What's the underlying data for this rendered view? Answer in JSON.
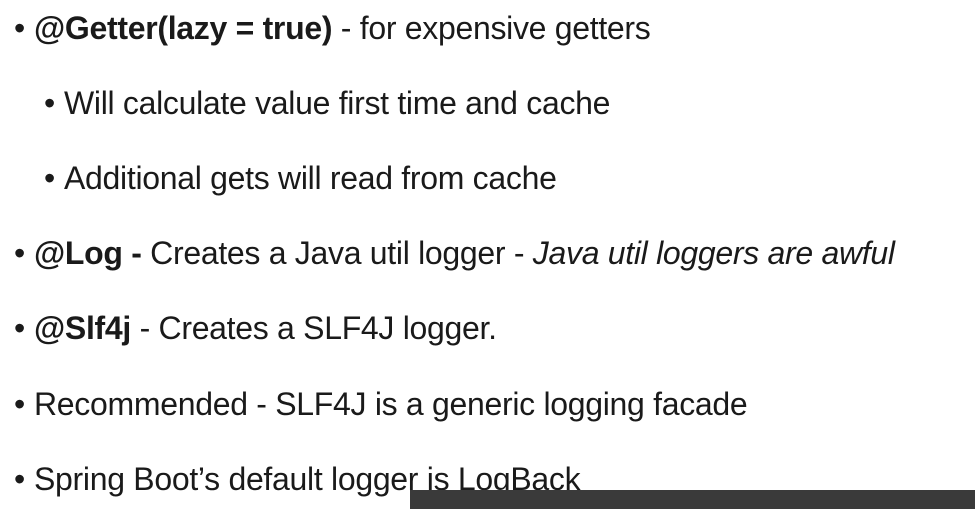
{
  "bullets": [
    {
      "bullet": "•",
      "bold": "@Getter(lazy = true)",
      "text": " - for expensive getters"
    },
    {
      "bullet": "•",
      "text": "Will calculate value first time and cache"
    },
    {
      "bullet": "•",
      "text": "Additional gets will read from cache"
    },
    {
      "bullet": "•",
      "bold": "@Log -",
      "text": " Creates a Java util logger - ",
      "italic": "Java util loggers are awful"
    },
    {
      "bullet": "•",
      "bold": "@Slf4j",
      "text": " - Creates a SLF4J logger."
    },
    {
      "bullet": "•",
      "text": "Recommended - SLF4J is a generic logging facade"
    },
    {
      "bullet": "•",
      "text": "Spring Boot’s default logger is LogBack"
    }
  ]
}
